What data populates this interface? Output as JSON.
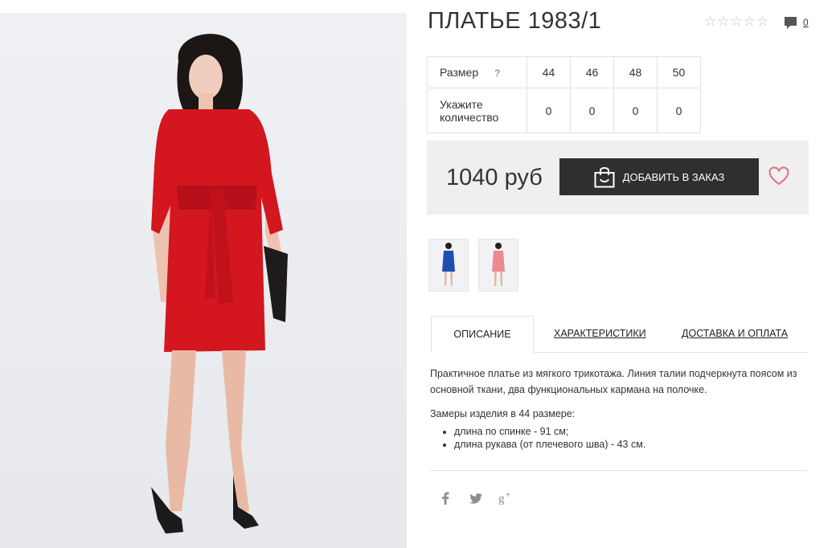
{
  "product": {
    "title": "ПЛАТЬЕ 1983/1",
    "rating": 0,
    "rating_max": 5,
    "comments_count": "0",
    "price": "1040 руб",
    "add_to_order_label": "ДОБАВИТЬ В ЗАКАЗ"
  },
  "size_table": {
    "size_label": "Размер",
    "help_mark": "?",
    "qty_label_line1": "Укажите",
    "qty_label_line2": "количество",
    "sizes": [
      "44",
      "46",
      "48",
      "50"
    ],
    "quantities": [
      "0",
      "0",
      "0",
      "0"
    ]
  },
  "variants": [
    {
      "name": "blue-dress",
      "color": "#1e4fb0"
    },
    {
      "name": "pink-dress",
      "color": "#e98b8f"
    }
  ],
  "photo": {
    "dress_color": "#d4161f"
  },
  "tabs": [
    {
      "label": "ОПИСАНИЕ",
      "active": true
    },
    {
      "label": "ХАРАКТЕРИСТИКИ",
      "active": false
    },
    {
      "label": "ДОСТАВКА И ОПЛАТА",
      "active": false
    }
  ],
  "description": {
    "text": "Практичное платье из мягкого трикотажа. Линия талии подчеркнута поясом из основной ткани, два функциональных кармана на полочке.",
    "measurements_title": "Замеры изделия в 44 размере:",
    "measurements": [
      "длина по спинке - 91 см;",
      "длина рукава (от плечевого шва) - 43 см."
    ]
  },
  "social": [
    "facebook-icon",
    "twitter-icon",
    "google-plus-icon"
  ],
  "colors": {
    "button_bg": "#2f2f2f",
    "buybox_bg": "#efefef",
    "heart": "#e0707a"
  }
}
